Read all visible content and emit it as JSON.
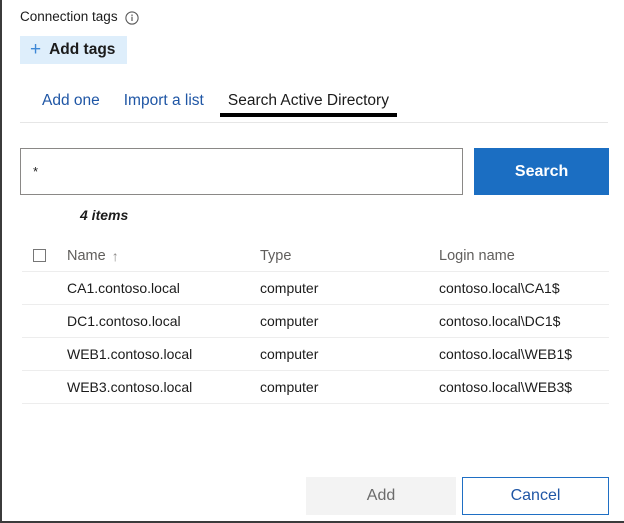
{
  "panel": {
    "section_label": "Connection tags",
    "info_icon": "info-circle-icon"
  },
  "add_tags_button": {
    "plus_glyph": "+",
    "label": "Add tags"
  },
  "tabs": [
    {
      "label": "Add one",
      "active": false
    },
    {
      "label": "Import a list",
      "active": false
    },
    {
      "label": "Search Active Directory",
      "active": true
    }
  ],
  "search": {
    "value": "*",
    "placeholder": "",
    "button_label": "Search"
  },
  "results": {
    "count_text": "4 items",
    "columns": {
      "name": "Name",
      "type": "Type",
      "login": "Login name"
    },
    "sort_arrow": "↑",
    "rows": [
      {
        "name": "CA1.contoso.local",
        "type": "computer",
        "login": "contoso.local\\CA1$"
      },
      {
        "name": "DC1.contoso.local",
        "type": "computer",
        "login": "contoso.local\\DC1$"
      },
      {
        "name": "WEB1.contoso.local",
        "type": "computer",
        "login": "contoso.local\\WEB1$"
      },
      {
        "name": "WEB3.contoso.local",
        "type": "computer",
        "login": "contoso.local\\WEB3$"
      }
    ]
  },
  "footer": {
    "add_label": "Add",
    "cancel_label": "Cancel"
  },
  "colors": {
    "accent_blue": "#1b6ec2",
    "link_blue": "#1f56a5",
    "pill_blue_bg": "#deeefb",
    "active_tab_underline": "#000000",
    "disabled_button_bg": "#f3f3f3"
  }
}
